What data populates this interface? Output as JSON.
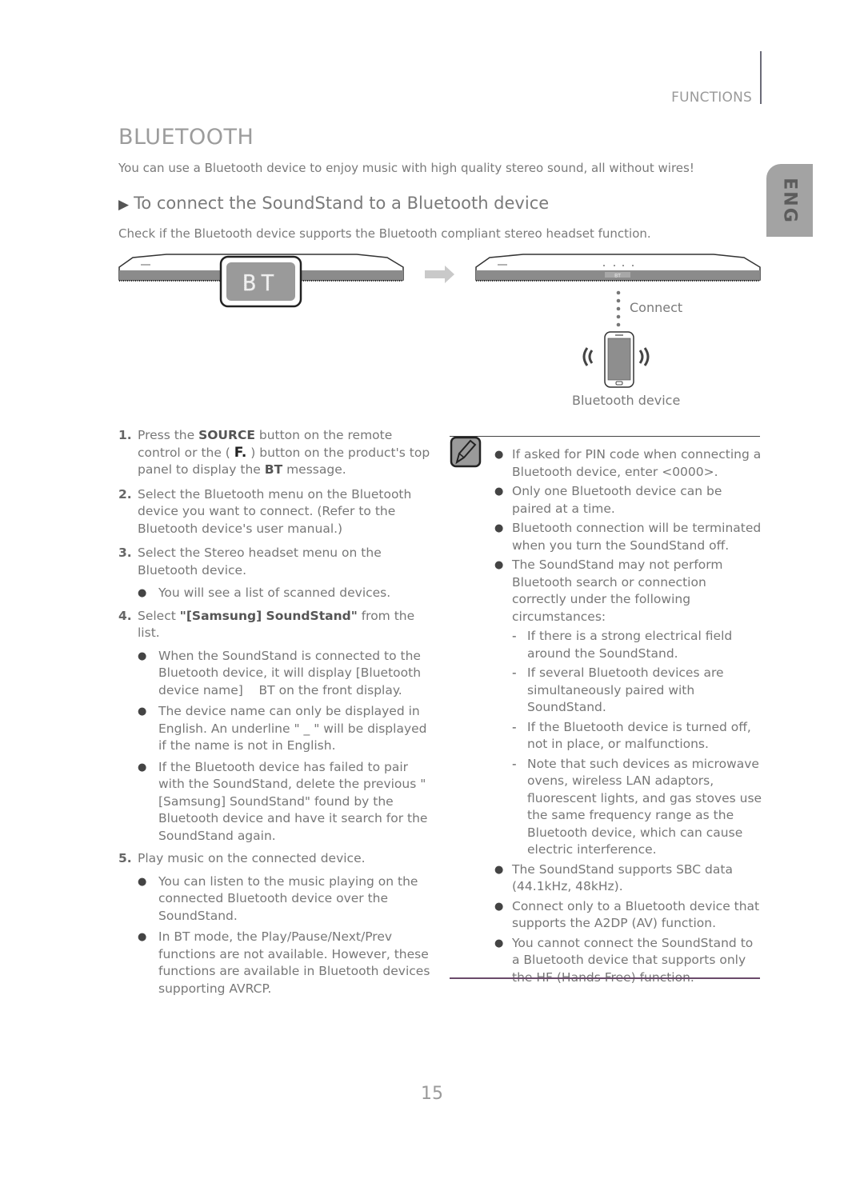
{
  "header": {
    "section": "FUNCTIONS",
    "language_tab": "ENG"
  },
  "page": {
    "title": "BLUETOOTH",
    "intro": "You can use a Bluetooth device to enjoy music with high quality stereo sound, all without wires!",
    "subheading": "To connect the SoundStand to a Bluetooth device",
    "check_note": "Check if the Bluetooth device supports the Bluetooth compliant stereo headset function.",
    "number": "15"
  },
  "illustration": {
    "display_text": "BT",
    "small_display_text": "BT",
    "connect_label": "Connect",
    "device_label": "Bluetooth device"
  },
  "steps": [
    {
      "num": "1.",
      "parts": [
        "Press the ",
        "SOURCE",
        " button on the remote control or the ( ",
        "F.",
        " ) button on the product's top panel to display the ",
        "BT",
        " message."
      ],
      "bullets": []
    },
    {
      "num": "2.",
      "parts": [
        "Select the Bluetooth menu on the Bluetooth device you want to connect. (Refer to the Bluetooth device's user manual.)"
      ],
      "bullets": []
    },
    {
      "num": "3.",
      "parts": [
        "Select the Stereo headset menu on the Bluetooth device."
      ],
      "bullets": [
        "You will see a list of scanned devices."
      ]
    },
    {
      "num": "4.",
      "parts": [
        "Select ",
        "\"[Samsung] SoundStand\"",
        " from the list."
      ],
      "bullets": [
        "When the SoundStand is connected to the Bluetooth device, it will display [Bluetooth device name]    BT on the front display.",
        "The device name can only be displayed in English. An underline \" _ \" will be displayed if the name is not in English.",
        "If the Bluetooth device has failed to pair with the SoundStand, delete the previous \"[Samsung] SoundStand\" found by the Bluetooth device and have it search for the SoundStand again."
      ]
    },
    {
      "num": "5.",
      "parts": [
        "Play music on the connected device."
      ],
      "bullets": [
        "You can listen to the music playing on the connected Bluetooth device over the SoundStand.",
        "In BT mode, the Play/Pause/Next/Prev functions are not available. However, these functions are available in Bluetooth devices supporting AVRCP."
      ]
    }
  ],
  "notes": {
    "items": [
      "If asked for PIN code when connecting a Bluetooth device, enter <0000>.",
      "Only one Bluetooth device can be paired at a time.",
      "Bluetooth connection will be terminated when you turn the SoundStand off.",
      "The SoundStand may not perform Bluetooth search or connection correctly under the following circumstances:"
    ],
    "circumstances": [
      "If there is a strong electrical field around the SoundStand.",
      "If several Bluetooth devices are simultaneously paired with SoundStand.",
      "If the Bluetooth device is turned off, not in place, or malfunctions.",
      "Note that such devices as microwave ovens, wireless LAN adaptors, fluorescent lights, and gas stoves use the same frequency range as the Bluetooth device, which can cause electric interference."
    ],
    "items_after": [
      "The SoundStand supports SBC data (44.1kHz, 48kHz).",
      "Connect only to a Bluetooth device that supports the A2DP (AV) function.",
      "You cannot connect the SoundStand to a Bluetooth device that supports only the HF (Hands Free) function."
    ]
  }
}
